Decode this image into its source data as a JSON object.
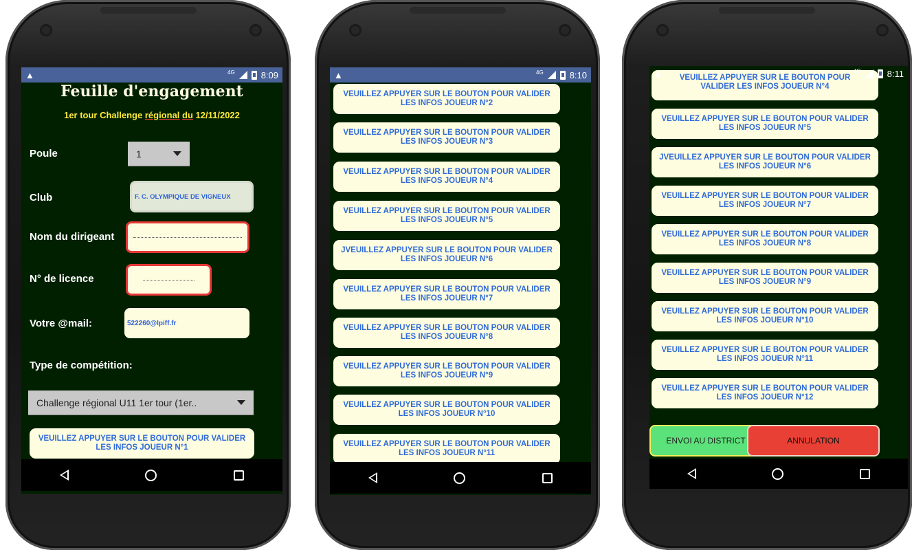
{
  "status": {
    "phone1_time": "8:09",
    "phone2_time": "8:10",
    "phone3_time": "8:11",
    "network": "4G",
    "warning": "▲"
  },
  "form": {
    "title": "Feuille d'engagement",
    "subtitle_pre": "1er tour Challenge ",
    "subtitle_regional": "régional",
    "subtitle_mid": " ",
    "subtitle_du": "du",
    "subtitle_date": " 12/11/2022",
    "poule_label": "Poule",
    "poule_value": "1",
    "club_label": "Club",
    "club_value": "F. C. OLYMPIQUE DE VIGNEUX",
    "dirigeant_label": "Nom du dirigeant",
    "licence_label": "N° de licence",
    "mail_label": "Votre @mail:",
    "mail_value": "522260@lpiff.fr",
    "competition_label": "Type de compétition:",
    "competition_value": "Challenge régional U11 1er tour (1er.."
  },
  "buttons": {
    "b1": "VEUILLEZ APPUYER SUR LE BOUTON POUR VALIDER LES INFOS JOUEUR N°1",
    "b2": "VEUILLEZ APPUYER SUR LE BOUTON POUR VALIDER LES INFOS JOUEUR N°2",
    "b3": "VEUILLEZ APPUYER SUR LE BOUTON POUR VALIDER LES INFOS JOUEUR N°3",
    "b4": "VEUILLEZ APPUYER SUR LE BOUTON POUR VALIDER LES INFOS JOUEUR N°4",
    "b5": "VEUILLEZ APPUYER SUR LE BOUTON POUR VALIDER LES INFOS JOUEUR N°5",
    "b6": "JVEUILLEZ APPUYER SUR LE BOUTON POUR VALIDER LES INFOS JOUEUR N°6",
    "b7": "VEUILLEZ APPUYER SUR LE BOUTON POUR VALIDER LES INFOS JOUEUR N°7",
    "b8": "VEUILLEZ APPUYER SUR LE BOUTON POUR VALIDER LES INFOS JOUEUR N°8",
    "b9": "VEUILLEZ APPUYER SUR LE BOUTON POUR VALIDER LES INFOS JOUEUR N°9",
    "b10": "VEUILLEZ APPUYER SUR LE BOUTON POUR VALIDER LES INFOS JOUEUR N°10",
    "b11": "VEUILLEZ APPUYER SUR LE BOUTON POUR VALIDER LES INFOS JOUEUR N°11",
    "b12": "VEUILLEZ APPUYER SUR LE BOUTON POUR VALIDER LES INFOS JOUEUR N°12",
    "b4_partial": "VEUILLEZ APPUYER SUR LE BOUTON POUR"
  },
  "actions": {
    "send": "ENVOI AU DISTRICT",
    "cancel": "ANNULATION"
  },
  "colors": {
    "screen_bg": "#002000",
    "statusbar": "#49639a",
    "button_bg": "#fffde0",
    "button_text": "#2f6bd8",
    "send": "#5ce27a",
    "cancel": "#e94035"
  }
}
